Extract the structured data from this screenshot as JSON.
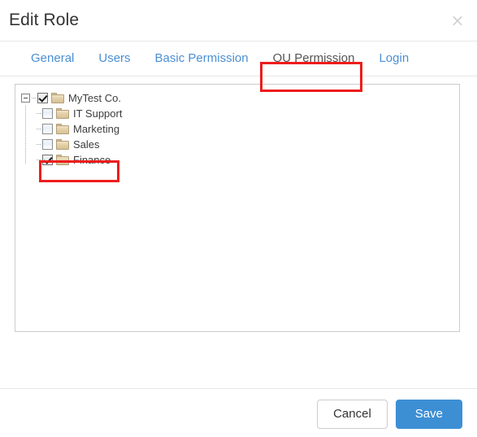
{
  "dialog": {
    "title": "Edit Role",
    "close_icon": "close-icon",
    "close_glyph": "×"
  },
  "tabs": [
    {
      "label": "General",
      "active": false
    },
    {
      "label": "Users",
      "active": false
    },
    {
      "label": "Basic Permission",
      "active": false
    },
    {
      "label": "OU Permission",
      "active": true
    },
    {
      "label": "Login",
      "active": false
    }
  ],
  "tree": {
    "root": {
      "label": "MyTest Co.",
      "checked": true,
      "expanded": true,
      "expander_icon": "collapse-minus-icon",
      "folder_icon": "folder-icon"
    },
    "children": [
      {
        "label": "IT Support",
        "checked": false,
        "folder_icon": "folder-icon"
      },
      {
        "label": "Marketing",
        "checked": false,
        "folder_icon": "folder-icon"
      },
      {
        "label": "Sales",
        "checked": false,
        "folder_icon": "folder-icon"
      },
      {
        "label": "Finance",
        "checked": true,
        "folder_icon": "folder-icon"
      }
    ]
  },
  "footer": {
    "cancel_label": "Cancel",
    "save_label": "Save"
  },
  "annotations": [
    {
      "name": "highlight-ou-permission-tab",
      "color": "#ee1c1c"
    },
    {
      "name": "highlight-finance-node",
      "color": "#ee1c1c"
    }
  ],
  "colors": {
    "accent": "#3d8fd4",
    "tab_link": "#4a8fd4",
    "tab_active_text": "#555555",
    "annotation": "#ee1c1c",
    "folder": "#e3d0a7",
    "panel_border": "#cccccc"
  }
}
